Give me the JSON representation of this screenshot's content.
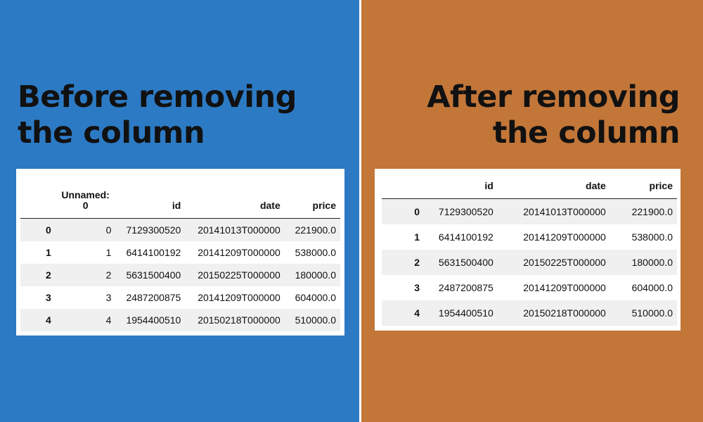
{
  "left": {
    "heading_line1": "Before removing",
    "heading_line2": "the column",
    "background": "#2d7ac4",
    "columns": [
      "",
      "Unnamed:\n0",
      "id",
      "date",
      "price"
    ],
    "rows": [
      {
        "index": "0",
        "unnamed": "0",
        "id": "7129300520",
        "date": "20141013T000000",
        "price": "221900.0"
      },
      {
        "index": "1",
        "unnamed": "1",
        "id": "6414100192",
        "date": "20141209T000000",
        "price": "538000.0"
      },
      {
        "index": "2",
        "unnamed": "2",
        "id": "5631500400",
        "date": "20150225T000000",
        "price": "180000.0"
      },
      {
        "index": "3",
        "unnamed": "3",
        "id": "2487200875",
        "date": "20141209T000000",
        "price": "604000.0"
      },
      {
        "index": "4",
        "unnamed": "4",
        "id": "1954400510",
        "date": "20150218T000000",
        "price": "510000.0"
      }
    ]
  },
  "right": {
    "heading_line1": "After removing",
    "heading_line2": "the column",
    "background": "#c27638",
    "columns": [
      "",
      "id",
      "date",
      "price"
    ],
    "rows": [
      {
        "index": "0",
        "id": "7129300520",
        "date": "20141013T000000",
        "price": "221900.0"
      },
      {
        "index": "1",
        "id": "6414100192",
        "date": "20141209T000000",
        "price": "538000.0"
      },
      {
        "index": "2",
        "id": "5631500400",
        "date": "20150225T000000",
        "price": "180000.0"
      },
      {
        "index": "3",
        "id": "2487200875",
        "date": "20141209T000000",
        "price": "604000.0"
      },
      {
        "index": "4",
        "id": "1954400510",
        "date": "20150218T000000",
        "price": "510000.0"
      }
    ]
  }
}
